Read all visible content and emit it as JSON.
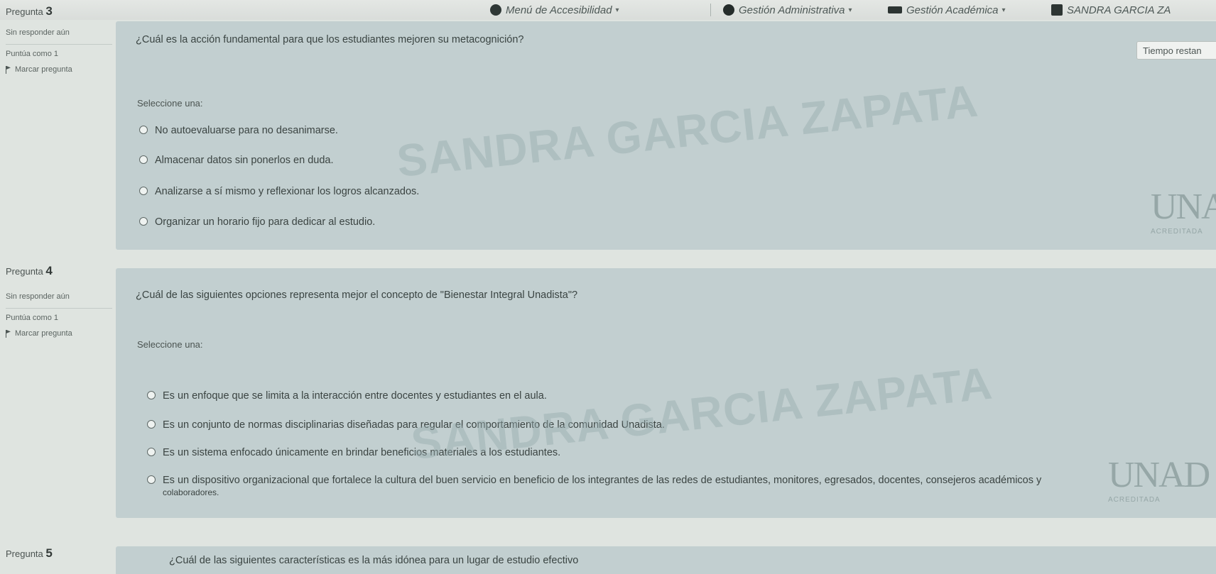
{
  "topbar": {
    "items": [
      {
        "label": "Menú de Accesibilidad",
        "icon": "accessibility-icon"
      },
      {
        "label": "Gestión Administrativa",
        "icon": "admin-icon"
      },
      {
        "label": "Gestión Académica",
        "icon": "academic-icon"
      },
      {
        "label": "SANDRA GARCIA ZA",
        "icon": "user-avatar"
      }
    ]
  },
  "timer": {
    "label": "Tiempo restan"
  },
  "watermark": {
    "text": "SANDRA GARCIA ZAPATA"
  },
  "logo": {
    "text": "UNAD",
    "badge": "ACREDITADA"
  },
  "questions": [
    {
      "number_label": "Pregunta",
      "number": "3",
      "status": "Sin responder aún",
      "points": "Puntúa como 1",
      "flag": "Marcar pregunta",
      "text": "¿Cuál es la acción fundamental para que los estudiantes mejoren su metacognición?",
      "prompt": "Seleccione una:",
      "options": [
        "No autoevaluarse para no desanimarse.",
        "Almacenar datos sin ponerlos en duda.",
        "Analizarse a sí mismo y reflexionar los logros alcanzados.",
        "Organizar un horario fijo para dedicar al estudio."
      ]
    },
    {
      "number_label": "Pregunta",
      "number": "4",
      "status": "Sin responder aún",
      "points": "Puntúa como 1",
      "flag": "Marcar pregunta",
      "text": "¿Cuál de las siguientes opciones representa mejor el concepto de \"Bienestar Integral Unadista\"?",
      "prompt": "Seleccione una:",
      "options": [
        "Es un enfoque que se limita a la interacción entre docentes y estudiantes en el aula.",
        "Es un conjunto de normas disciplinarias diseñadas para regular el comportamiento de la comunidad Unadista.",
        "Es un sistema enfocado únicamente en brindar beneficios materiales a los estudiantes.",
        "Es un dispositivo organizacional que fortalece la cultura del buen servicio en beneficio de los integrantes de las redes de estudiantes, monitores, egresados, docentes, consejeros académicos y",
        "colaboradores."
      ]
    },
    {
      "number_label": "Pregunta",
      "number": "5",
      "text": "¿Cuál de las siguientes características es la más idónea para un lugar de estudio efectivo"
    }
  ]
}
